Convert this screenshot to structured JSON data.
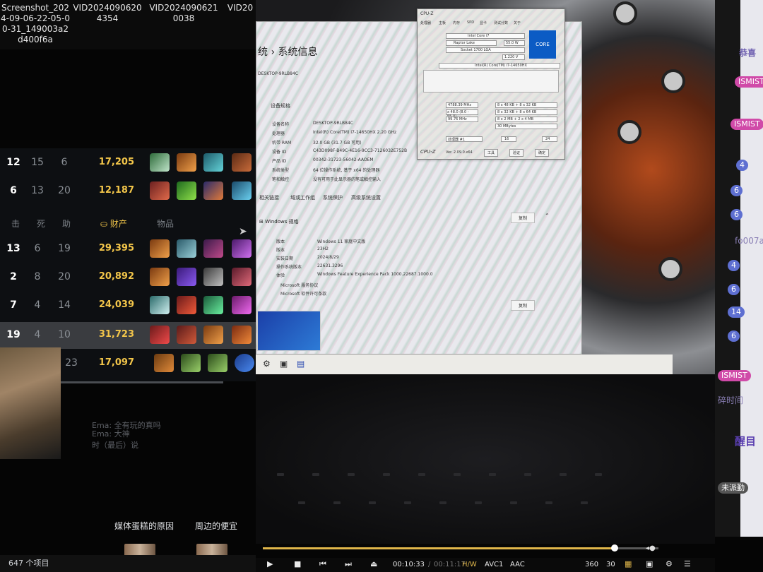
{
  "explorer": {
    "files": [
      {
        "name": "Screenshot_2024-09-06-22-05-00-31_149003a2d400f6a"
      },
      {
        "name": "VID20240906204354"
      },
      {
        "name": "VID20240906210038"
      },
      {
        "name": "VID20"
      }
    ],
    "item_count": "647 个项目",
    "media_labels": [
      "媒体蛋糕的原因",
      "周边的便宜"
    ]
  },
  "scoreboard": {
    "header": {
      "kills": "击",
      "deaths": "死",
      "assists": "助",
      "gold": "财产",
      "items": "物品"
    },
    "rows": [
      {
        "k": "12",
        "d": "15",
        "a": "6",
        "gold": "17,205",
        "highlight": false
      },
      {
        "k": "6",
        "d": "13",
        "a": "20",
        "gold": "12,187",
        "highlight": false
      },
      {
        "k": "13",
        "d": "6",
        "a": "19",
        "gold": "29,395",
        "highlight": false
      },
      {
        "k": "2",
        "d": "8",
        "a": "20",
        "gold": "20,892",
        "highlight": false
      },
      {
        "k": "7",
        "d": "4",
        "a": "14",
        "gold": "24,039",
        "highlight": false
      },
      {
        "k": "19",
        "d": "4",
        "a": "10",
        "gold": "31,723",
        "highlight": true
      },
      {
        "k": "",
        "d": "",
        "a": "23",
        "gold": "17,097",
        "highlight": false
      }
    ],
    "chat_lines": [
      "Ema: 全有玩的真吗",
      "Ema: 大神",
      "时（最后）说"
    ]
  },
  "laptop_screen": {
    "settings_window": {
      "breadcrumb": "统 › 系统信息",
      "device_name_short": "DESKTOP-9RLB84C",
      "device_spec_header": "设备规格",
      "specs": [
        {
          "label": "设备名称",
          "value": "DESKTOP-9RLB84C"
        },
        {
          "label": "处理器",
          "value": "Intel(R) Core(TM) i7-14650HX  2.20 GHz"
        },
        {
          "label": "机带 RAM",
          "value": "32.0 GB (31.7 GB 可用)"
        },
        {
          "label": "设备 ID",
          "value": "C43D098F-B49C-4E16-9CC3-7126032E752B"
        },
        {
          "label": "产品 ID",
          "value": "00342-31723-56042-AAOEM"
        },
        {
          "label": "系统类型",
          "value": "64 位操作系统, 基于 x64 的处理器"
        },
        {
          "label": "笔和触控",
          "value": "没有可用于此显示器的笔或触控输入"
        }
      ],
      "related_links": [
        "相关链接",
        "域或工作组",
        "系统保护",
        "高级系统设置"
      ],
      "windows_section": "Windows 规格",
      "copy_label": "复制",
      "windows_specs": [
        {
          "label": "版本",
          "value": "Windows 11 家庭中文版"
        },
        {
          "label": "版本",
          "value": "23H2"
        },
        {
          "label": "安装日期",
          "value": "2024/8/29"
        },
        {
          "label": "操作系统版本",
          "value": "22631.3296"
        },
        {
          "label": "体验",
          "value": "Windows Feature Experience Pack 1000.22687.1000.0"
        }
      ],
      "ms_links": [
        "Microsoft 服务协议",
        "Microsoft 软件许可条款"
      ]
    },
    "cpuz": {
      "title": "CPU-Z",
      "tabs": [
        "处理器",
        "主板",
        "内存",
        "SPD",
        "显卡",
        "测试分数",
        "关于"
      ],
      "name": "Intel Core i7",
      "codename": "Raptor Lake",
      "tdp": "55.0 W",
      "package": "Socket 1700 LGA",
      "core_voltage": "1.220 V",
      "spec": "Intel(R) Core(TM) i7-14650HX",
      "core_speed": "4788.39 MHz",
      "multiplier": "x 48.0 (8.0 - 55.0)",
      "bus_speed": "99.76 MHz",
      "cache": [
        "8 x 48 KB + 8 x 32 KB",
        "8 x 32 KB + 8 x 64 KB",
        "8 x 2 MB + 2 x 4 MB",
        "30 MBytes"
      ],
      "selection": "处理器 #1",
      "cores": "16",
      "threads": "24",
      "version": "Ver. 2.09.0.x64",
      "buttons": [
        "工具",
        "验证",
        "确定"
      ],
      "logo_text": "CORE"
    }
  },
  "player": {
    "elapsed": "00:10:33",
    "total": "00:11:17",
    "progress": 0.89,
    "hw": "H/W",
    "video_codec": "AVC1",
    "audio_codec": "AAC",
    "res": "360",
    "fps": "30"
  },
  "chat": {
    "fragments": [
      "恭喜",
      "ISMIST",
      "ISMIST",
      "ISMIST",
      "fo007ah",
      "碎时间",
      "醒目",
      "未派勤"
    ],
    "levels": [
      "4",
      "6",
      "6",
      "4",
      "6",
      "14",
      "6"
    ],
    "badge_color_blue": "#5e6fd1",
    "badge_color_pink": "#d04aa8"
  }
}
